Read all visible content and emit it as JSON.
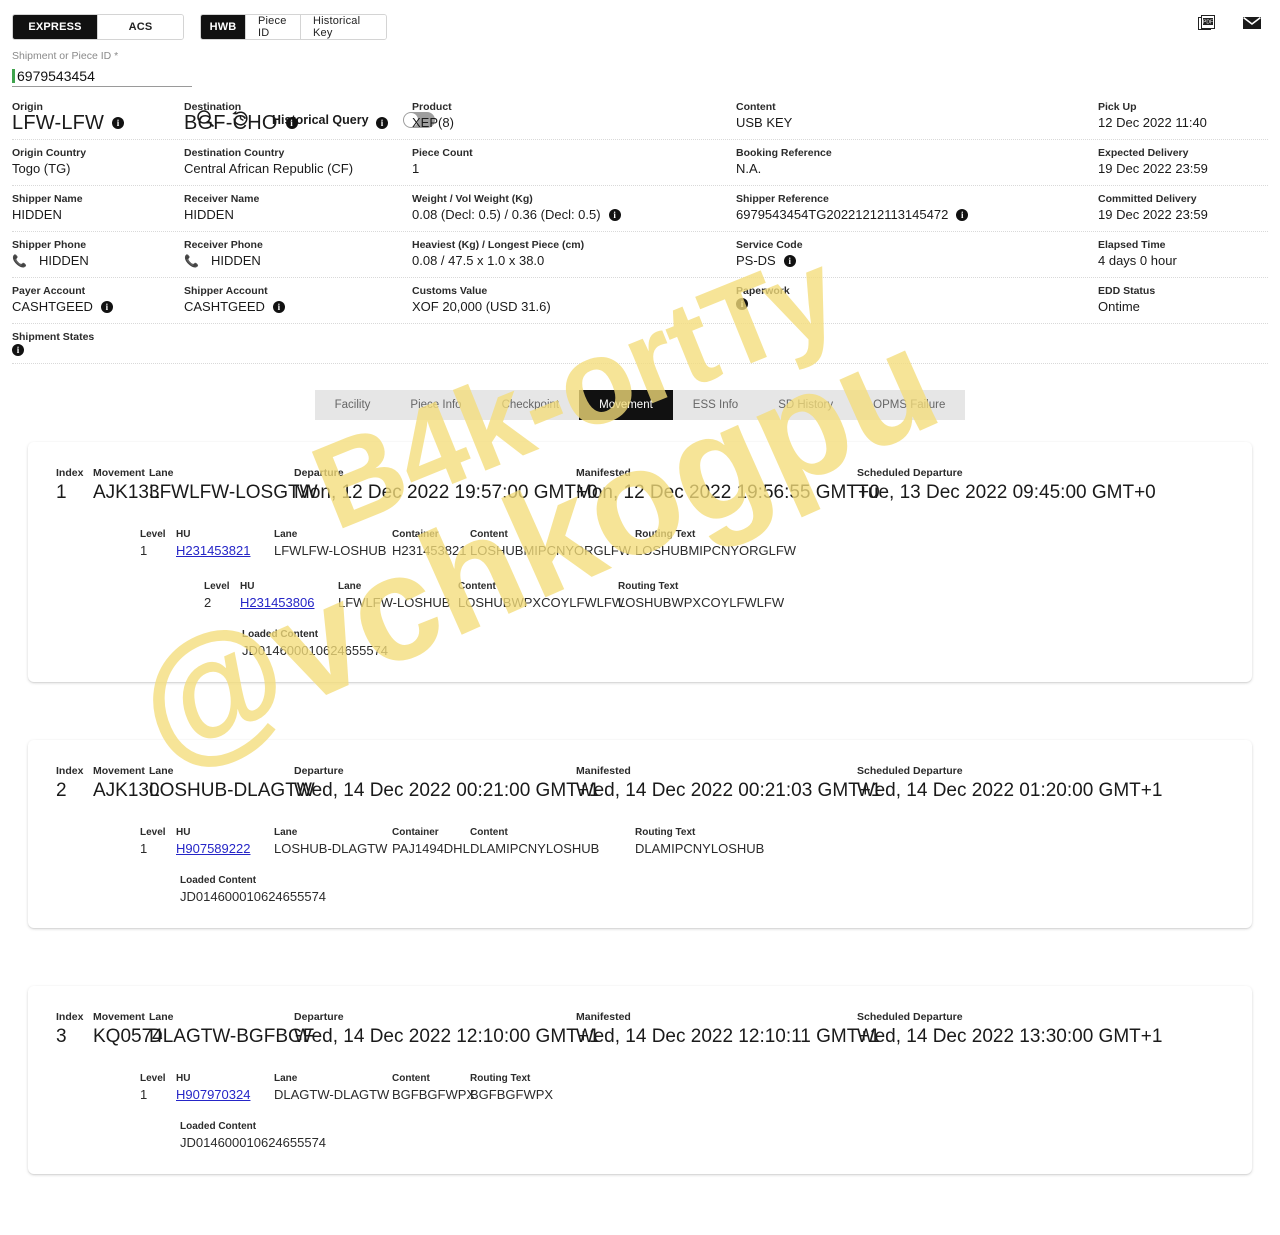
{
  "topbar": {
    "mode_tabs": [
      {
        "label": "EXPRESS",
        "active": true
      },
      {
        "label": "ACS",
        "active": false
      }
    ],
    "id_tabs": [
      {
        "label": "HWB",
        "active": true
      },
      {
        "label": "Piece ID",
        "active": false
      },
      {
        "label": "Historical Key",
        "active": false
      }
    ],
    "icons": [
      {
        "name": "pdf-icon",
        "label": "PDF"
      },
      {
        "name": "mail-icon",
        "label": "Mail"
      }
    ]
  },
  "search": {
    "label": "Shipment or Piece ID *",
    "value": "6979543454",
    "placeholder": "Shipment or Piece ID",
    "search_icon": "search-icon",
    "history_icon": "history-icon",
    "historical_query_label": "Historical Query",
    "historical_query_on": false,
    "caret_color": "#3fa34d"
  },
  "details": {
    "rows": [
      [
        {
          "label": "Origin",
          "value": "LFW-LFW",
          "big": true,
          "info": true
        },
        {
          "label": "Destination",
          "value": "BGF-CHO",
          "big": true,
          "info": true
        },
        {
          "label": "Product",
          "value": "XEP(8)",
          "info": false
        },
        {
          "label": "Content",
          "value": "USB KEY",
          "info": false
        },
        {
          "label": "Pick Up",
          "value": "12 Dec 2022 11:40",
          "info": false
        }
      ],
      [
        {
          "label": "Origin Country",
          "value": "Togo (TG)",
          "info": false
        },
        {
          "label": "Destination Country",
          "value": "Central African Republic (CF)",
          "info": false
        },
        {
          "label": "Piece Count",
          "value": "1",
          "info": false
        },
        {
          "label": "Booking Reference",
          "value": "N.A.",
          "info": false
        },
        {
          "label": "Expected Delivery",
          "value": "19 Dec 2022 23:59",
          "info": false
        }
      ],
      [
        {
          "label": "Shipper Name",
          "value": "HIDDEN",
          "info": false
        },
        {
          "label": "Receiver Name",
          "value": "HIDDEN",
          "info": false
        },
        {
          "label": "Weight / Vol Weight (Kg)",
          "value": "0.08 (Decl: 0.5) / 0.36 (Decl: 0.5)",
          "info": true
        },
        {
          "label": "Shipper Reference",
          "value": "6979543454TG20221212113145472",
          "info": true
        },
        {
          "label": "Committed Delivery",
          "value": "19 Dec 2022 23:59",
          "info": false
        }
      ],
      [
        {
          "label": "Shipper Phone",
          "value": "HIDDEN",
          "phone": true,
          "info": false
        },
        {
          "label": "Receiver Phone",
          "value": "HIDDEN",
          "phone": true,
          "info": false
        },
        {
          "label": "Heaviest (Kg) / Longest Piece (cm)",
          "value": "0.08 / 47.5 x 1.0 x 38.0",
          "info": false
        },
        {
          "label": "Service Code",
          "value": "PS-DS",
          "info": true
        },
        {
          "label": "Elapsed Time",
          "value": "4 days 0 hour",
          "info": false
        }
      ],
      [
        {
          "label": "Payer Account",
          "value": "CASHTGEED",
          "info": true
        },
        {
          "label": "Shipper Account",
          "value": "CASHTGEED",
          "info": true
        },
        {
          "label": "Customs Value",
          "value": "XOF 20,000 (USD 31.6)",
          "info": false
        },
        {
          "label": "Paperwork",
          "value": "",
          "info": true
        },
        {
          "label": "EDD Status",
          "value": "Ontime",
          "info": false
        }
      ],
      [
        {
          "label": "Shipment States",
          "value": "",
          "info": true
        },
        {
          "label": "",
          "value": "",
          "info": false
        },
        {
          "label": "",
          "value": "",
          "info": false
        },
        {
          "label": "",
          "value": "",
          "info": false
        },
        {
          "label": "",
          "value": "",
          "info": false
        }
      ]
    ]
  },
  "tabs": [
    {
      "label": "Facility",
      "active": false
    },
    {
      "label": "Piece Info",
      "active": false
    },
    {
      "label": "Checkpoint",
      "active": false
    },
    {
      "label": "Movement",
      "active": true
    },
    {
      "label": "ESS Info",
      "active": false
    },
    {
      "label": "SD History",
      "active": false
    },
    {
      "label": "OPMS Failure",
      "active": false
    }
  ],
  "movement_headers": {
    "index": "Index",
    "movement": "Movement",
    "lane": "Lane",
    "departure": "Departure",
    "manifested": "Manifested",
    "scheduled_departure": "Scheduled Departure",
    "level": "Level",
    "hu": "HU",
    "container": "Container",
    "content": "Content",
    "routing_text": "Routing Text",
    "loaded_content": "Loaded Content"
  },
  "movements": [
    {
      "index": "1",
      "movement": "AJK133",
      "lane": "LFWLFW-LOSGTW",
      "departure": "Mon, 12 Dec 2022 19:57:00 GMT+0",
      "manifested": "Mon, 12 Dec 2022 19:56:55 GMT+0",
      "scheduled_departure": "Tue, 13 Dec 2022 09:45:00 GMT+0",
      "level1": {
        "level": "1",
        "hu": "H231453821",
        "lane": "LFWLFW-LOSHUB",
        "container": "H231453821",
        "content": "LOSHUBMIPCNYORGLFW",
        "routing_text": "LOSHUBMIPCNYORGLFW"
      },
      "level2": {
        "level": "2",
        "hu": "H231453806",
        "lane": "LFWLFW-LOSHUB",
        "content": "LOSHUBWPXCOYLFWLFW",
        "routing_text": "LOSHUBWPXCOYLFWLFW"
      },
      "loaded_content": "JD014600010624655574",
      "loaded_indent": 2
    },
    {
      "index": "2",
      "movement": "AJK130",
      "lane": "LOSHUB-DLAGTW",
      "departure": "Wed, 14 Dec 2022 00:21:00 GMT+1",
      "manifested": "Wed, 14 Dec 2022 00:21:03 GMT+1",
      "scheduled_departure": "Wed, 14 Dec 2022 01:20:00 GMT+1",
      "level1": {
        "level": "1",
        "hu": "H907589222",
        "lane": "LOSHUB-DLAGTW",
        "container": "PAJ1494DHL",
        "content": "DLAMIPCNYLOSHUB",
        "routing_text": "DLAMIPCNYLOSHUB"
      },
      "level2": null,
      "loaded_content": "JD014600010624655574",
      "loaded_indent": 1
    },
    {
      "index": "3",
      "movement": "KQ0574",
      "lane": "DLAGTW-BGFBGF",
      "departure": "Wed, 14 Dec 2022 12:10:00 GMT+1",
      "manifested": "Wed, 14 Dec 2022 12:10:11 GMT+1",
      "scheduled_departure": "Wed, 14 Dec 2022 13:30:00 GMT+1",
      "level1": {
        "level": "1",
        "hu": "H907970324",
        "lane": "DLAGTW-DLAGTW",
        "container": null,
        "content": "BGFBGFWPX",
        "routing_text": "BGFBGFWPX"
      },
      "level2": null,
      "loaded_content": "JD014600010624655574",
      "loaded_indent": 1
    }
  ],
  "watermark": {
    "line1": "@vchkogpu",
    "line2": "B4k-ortTy",
    "color": "#f3dd7a"
  }
}
